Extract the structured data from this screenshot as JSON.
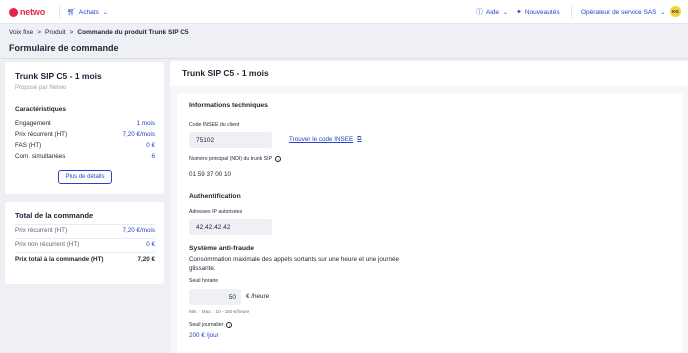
{
  "topbar": {
    "logo_text": "netwo",
    "achats_label": "Achats",
    "aide_label": "Aide",
    "nouveautes_label": "Nouveautés",
    "operator_label": "Opérateur de service SAS",
    "avatar_initials": "KG",
    "brand_color": "#e1264a",
    "accent_color": "#2744c9"
  },
  "breadcrumb": [
    "Voix fixe",
    "Produit",
    "Commande du produit Trunk SIP C5"
  ],
  "page_title": "Formulaire de commande",
  "product_card": {
    "title": "Trunk SIP C5 - 1 mois",
    "subtitle": "Proposé par Netwo",
    "section": "Caractéristiques",
    "rows": [
      {
        "label": "Engagement",
        "value": "1 mois"
      },
      {
        "label": "Prix récurrent (HT)",
        "value": "7,20 €/mois"
      },
      {
        "label": "FAS (HT)",
        "value": "0 €"
      },
      {
        "label": "Com. simultanées",
        "value": "6"
      }
    ],
    "details_button": "Plus de détails"
  },
  "total_card": {
    "title": "Total de la commande",
    "rows": [
      {
        "label": "Prix récurrent (HT)",
        "value": "7,20 €/mois"
      },
      {
        "label": "Prix non récurrent (HT)",
        "value": "0 €"
      },
      {
        "label": "Prix total à la commande (HT)",
        "value": "7,20 €"
      }
    ]
  },
  "form": {
    "title": "Trunk SIP C5 - 1 mois",
    "tech_title": "Informations techniques",
    "insee_label": "Code INSEE du client",
    "insee_value": "75102",
    "insee_link": "Trouver le code INSEE",
    "ndi_label": "Numéro principal (NDI) du trunk SIP",
    "ndi_value": "01 59 37 00 10",
    "auth_title": "Authentification",
    "ip_label": "Adresses IP autorisées",
    "ip_value": "42.42.42.42",
    "fraud_title": "Système anti-fraude",
    "fraud_desc": "Consommation maximale des appels sortants sur une heure et une journée glissante.",
    "hourly_label": "Seuil horaire",
    "hourly_value": "50",
    "hourly_unit": "€ /heure",
    "hourly_hint": "Min. · Max. : 10 - 150 €/heure",
    "daily_label": "Seuil journalier",
    "daily_value": "200 € /jour"
  }
}
